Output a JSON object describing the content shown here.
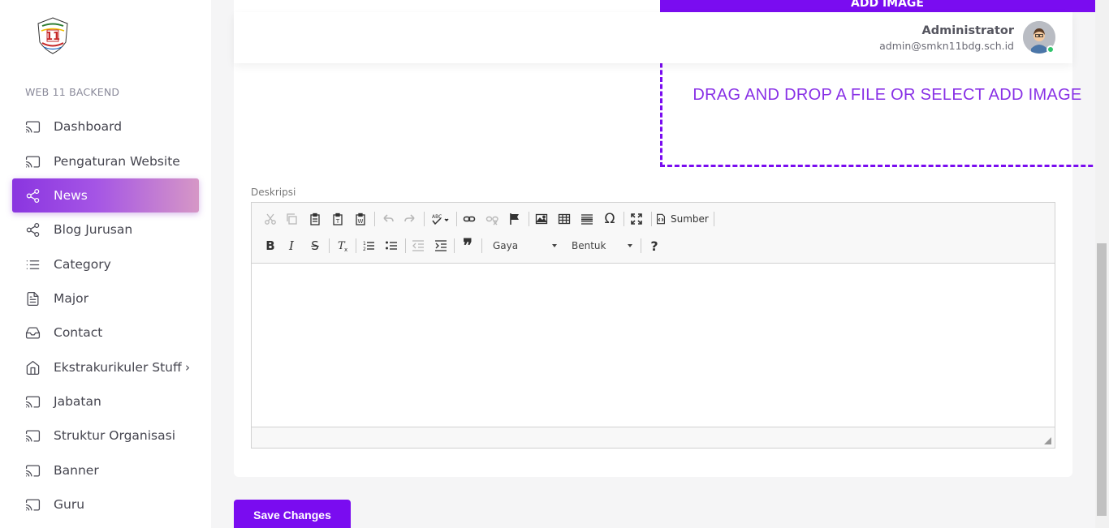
{
  "sidebar": {
    "section_label": "WEB 11 BACKEND",
    "items": [
      {
        "label": "Dashboard",
        "icon": "cast-icon"
      },
      {
        "label": "Pengaturan Website",
        "icon": "cast-icon"
      },
      {
        "label": "News",
        "icon": "share-icon",
        "active": true
      },
      {
        "label": "Blog Jurusan",
        "icon": "share-icon"
      },
      {
        "label": "Category",
        "icon": "list-icon"
      },
      {
        "label": "Major",
        "icon": "file-text-icon"
      },
      {
        "label": "Contact",
        "icon": "inbox-icon"
      },
      {
        "label": "Ekstrakurikuler Stuff",
        "icon": "home-icon",
        "has_submenu": true
      },
      {
        "label": "Jabatan",
        "icon": "cast-icon"
      },
      {
        "label": "Struktur Organisasi",
        "icon": "cast-icon"
      },
      {
        "label": "Banner",
        "icon": "cast-icon"
      },
      {
        "label": "Guru",
        "icon": "cast-icon"
      }
    ],
    "submenu_chevron": "›"
  },
  "header": {
    "user_name": "Administrator",
    "user_email": "admin@smkn11bdg.sch.id"
  },
  "image_upload": {
    "button_label": "ADD IMAGE",
    "dropzone_text": "DRAG AND DROP A FILE OR SELECT ADD IMAGE"
  },
  "form": {
    "description_label": "Deskripsi",
    "save_label": "Save Changes"
  },
  "editor": {
    "source_label": "Sumber",
    "style_combo": "Gaya",
    "format_combo": "Bentuk",
    "bold": "B",
    "italic": "I",
    "strike": "S",
    "help": "?",
    "omega": "Ω",
    "quote": "❞"
  },
  "colors": {
    "accent": "#7a0cf0",
    "active_gradient_start": "#8a35e0",
    "active_gradient_end": "#d697c6",
    "online": "#2fc46b"
  }
}
